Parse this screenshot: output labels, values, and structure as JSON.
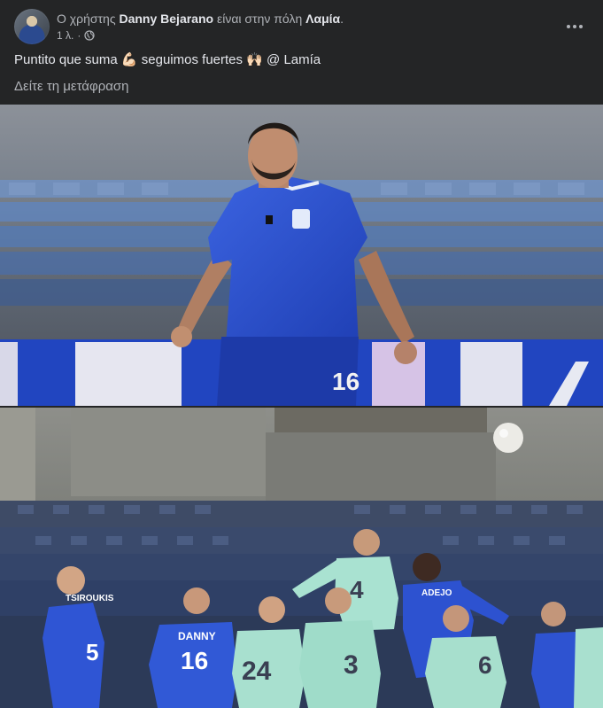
{
  "post": {
    "author_prefix": "Ο χρήστης",
    "author_name": "Danny Bejarano",
    "author_mid": "είναι στην πόλη",
    "place": "Λαμία",
    "place_suffix": ".",
    "time": "1 λ.",
    "separator": "·",
    "text_part1": "Puntito que suma",
    "emoji1": "💪🏻",
    "text_part2": "seguimos fuertes",
    "emoji2": "🙌🏻",
    "text_part3": "@ Lamía",
    "translate_label": "Δείτε τη μετάφραση"
  },
  "photo1": {
    "jersey_number": "16"
  },
  "photo2": {
    "players": [
      {
        "name": "TSIROUKIS",
        "number": "5"
      },
      {
        "name": "DANNY",
        "number": "16"
      },
      {
        "name": "",
        "number": "24"
      },
      {
        "name": "",
        "number": "3"
      },
      {
        "name": "ADEJO",
        "number": "4"
      },
      {
        "name": "",
        "number": "6"
      },
      {
        "name": "",
        "number": "4"
      }
    ]
  },
  "icons": {
    "globe": "globe-icon",
    "more": "more-options-icon"
  },
  "colors": {
    "background": "#242526",
    "primary_text": "#e4e6eb",
    "secondary_text": "#b0b3b8",
    "kit_blue": "#2f55d4",
    "kit_green": "#a8e0cf"
  }
}
